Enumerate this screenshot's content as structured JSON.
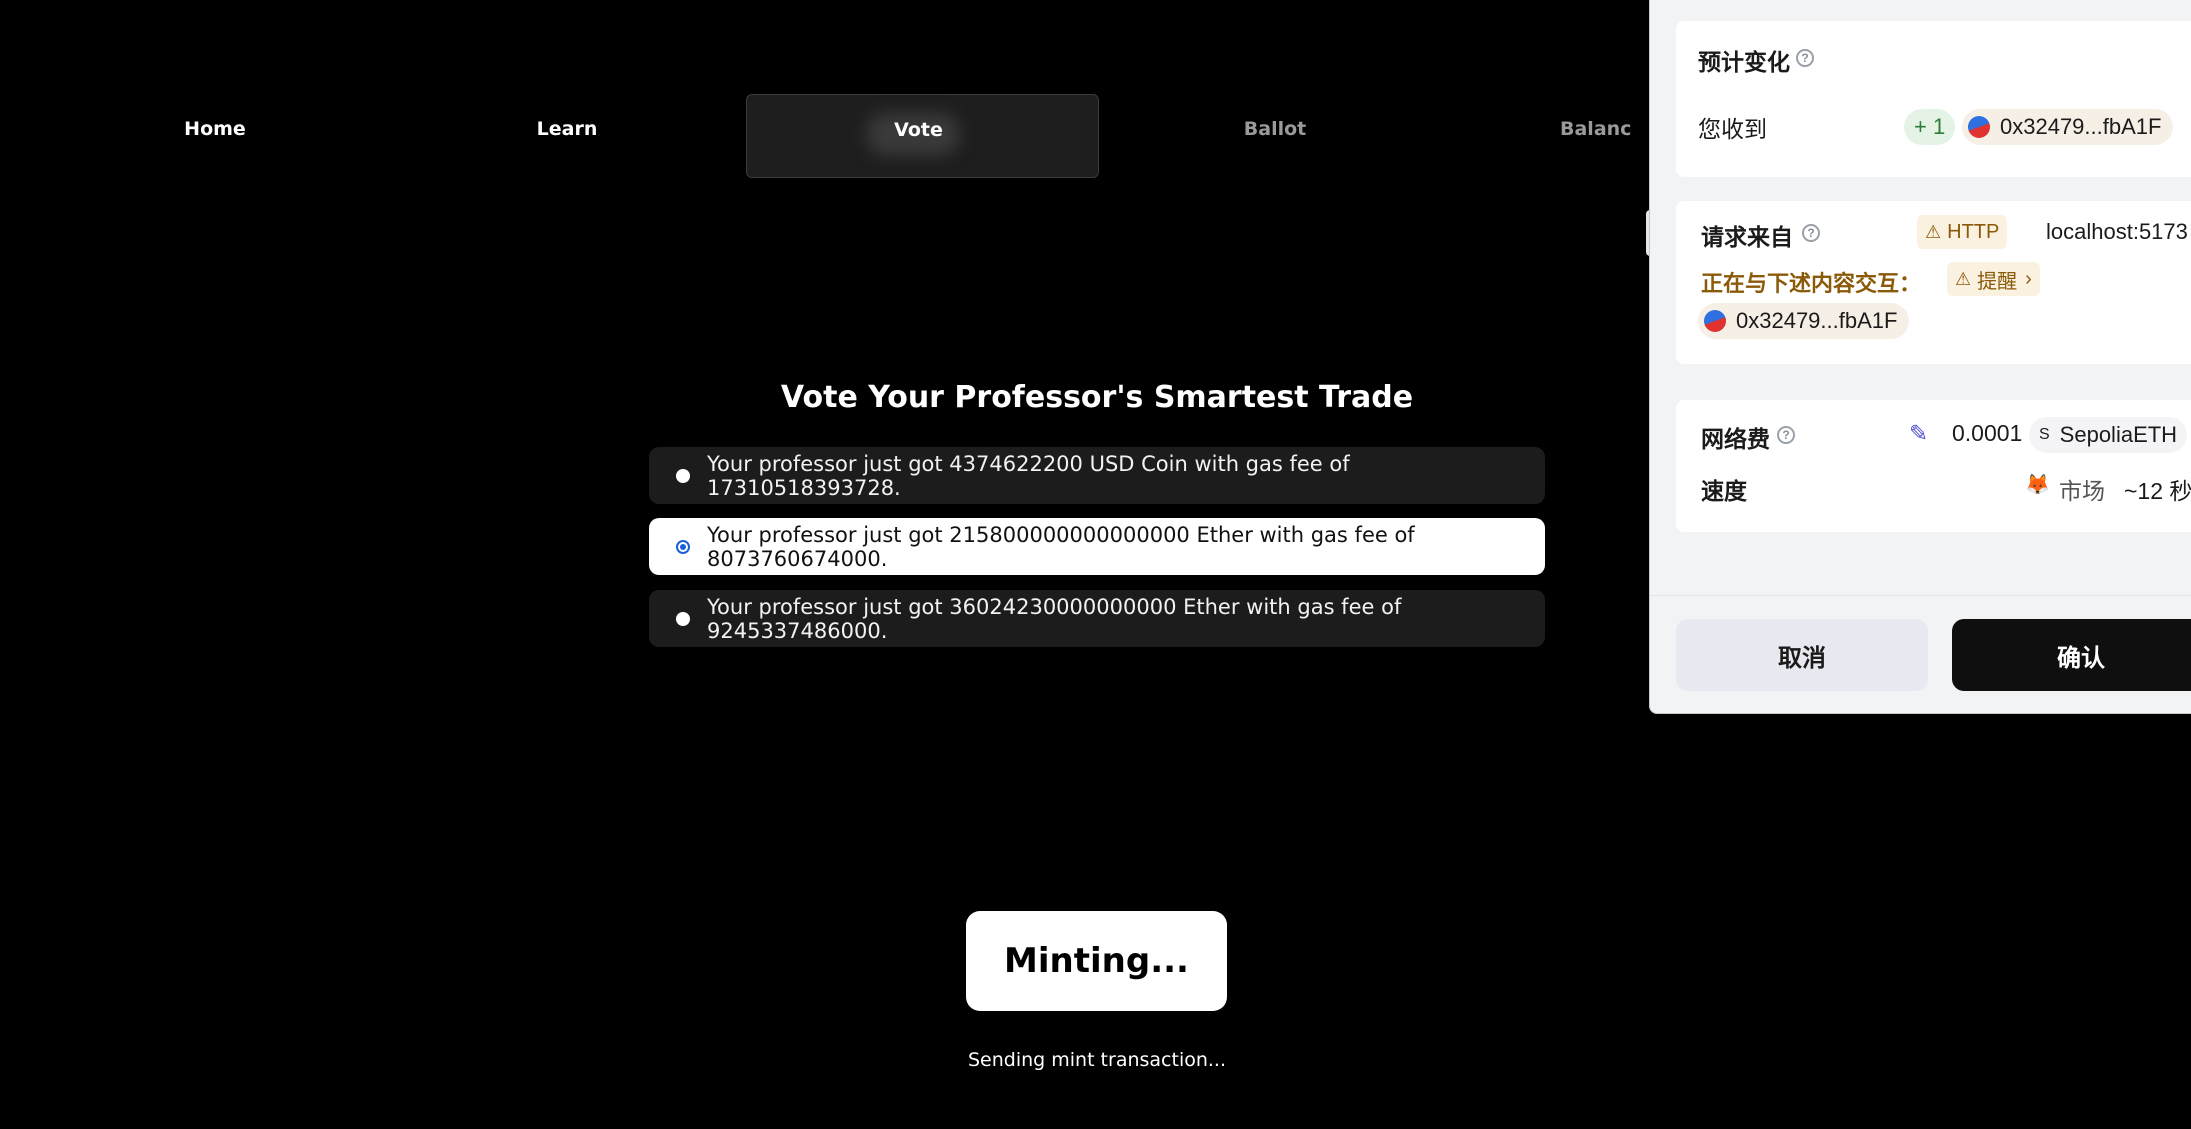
{
  "nav": {
    "home": "Home",
    "learn": "Learn",
    "vote": "Vote",
    "ballot": "Ballot",
    "balance": "Balanc"
  },
  "vote": {
    "title": "Vote Your Professor's Smartest Trade",
    "options": [
      {
        "text": "Your professor just got 4374622200 USD Coin with gas fee of 17310518393728.",
        "selected": false
      },
      {
        "text": "Your professor just got 215800000000000000 Ether with gas fee of 8073760674000.",
        "selected": true
      },
      {
        "text": "Your professor just got 36024230000000000 Ether with gas fee of 9245337486000.",
        "selected": false
      }
    ]
  },
  "mint": {
    "button": "Minting...",
    "status": "Sending mint transaction..."
  },
  "wallet": {
    "expected_change_label": "预计变化",
    "receive_label": "您收到",
    "receive_amount": "+ 1",
    "receive_address": "0x32479...fbA1F",
    "request_from_label": "请求来自",
    "http_badge": "HTTP",
    "origin": "localhost:5173",
    "interacting_label": "正在与下述内容交互：",
    "alert_badge": "提醒",
    "contract_address": "0x32479...fbA1F",
    "network_fee_label": "网络费",
    "fee_amount": "0.0001",
    "fee_currency_symbol": "S",
    "fee_currency": "SepoliaETH",
    "speed_label": "速度",
    "speed_mode": "市场",
    "speed_time": "~12 秒",
    "cancel": "取消",
    "confirm": "确认",
    "help_glyph": "?",
    "warning_glyph": "⚠",
    "chevron_glyph": "›",
    "edit_glyph": "✎",
    "fox_glyph": "🦊"
  },
  "colors": {
    "background": "#000000",
    "accent": "#1a5fd6",
    "warning": "#8a5a08"
  }
}
